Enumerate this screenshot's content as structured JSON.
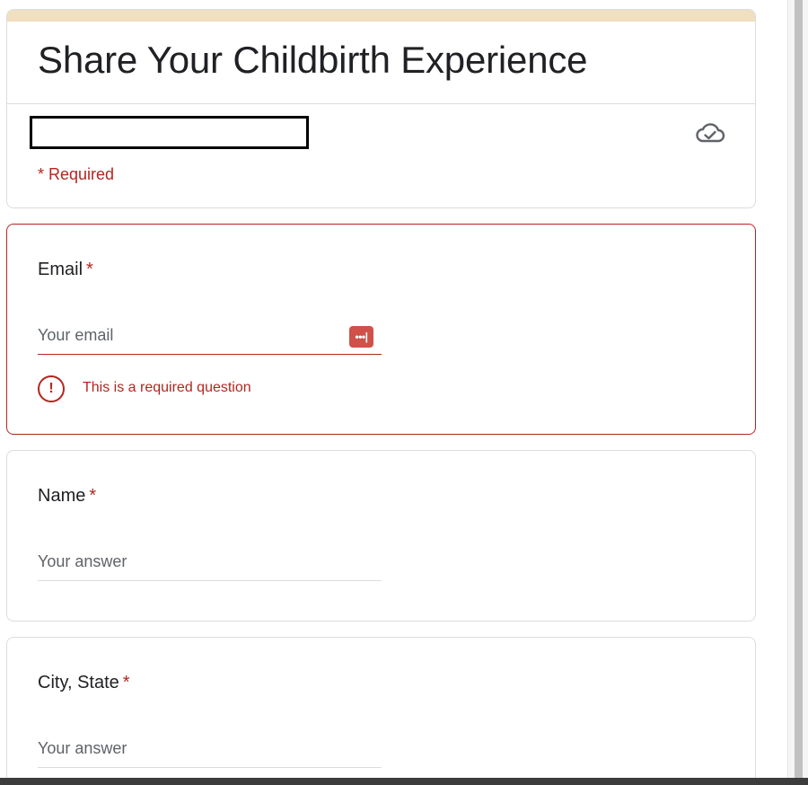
{
  "form": {
    "title": "Share Your Childbirth Experience",
    "required_note": "* Required",
    "accent_color": "#f0e0c0",
    "error_color": "#b3261e"
  },
  "questions": [
    {
      "title": "Email",
      "required_marker": "*",
      "placeholder": "Your email",
      "value": "",
      "error": "This is a required question"
    },
    {
      "title": "Name",
      "required_marker": "*",
      "placeholder": "Your answer",
      "value": ""
    },
    {
      "title": "City, State",
      "required_marker": "*",
      "placeholder": "Your answer",
      "value": ""
    }
  ],
  "icons": {
    "saved": "cloud-check-icon",
    "password_manager": "password-manager-icon",
    "password_manager_glyph": "•••|",
    "error": "error-icon",
    "error_glyph": "!"
  }
}
